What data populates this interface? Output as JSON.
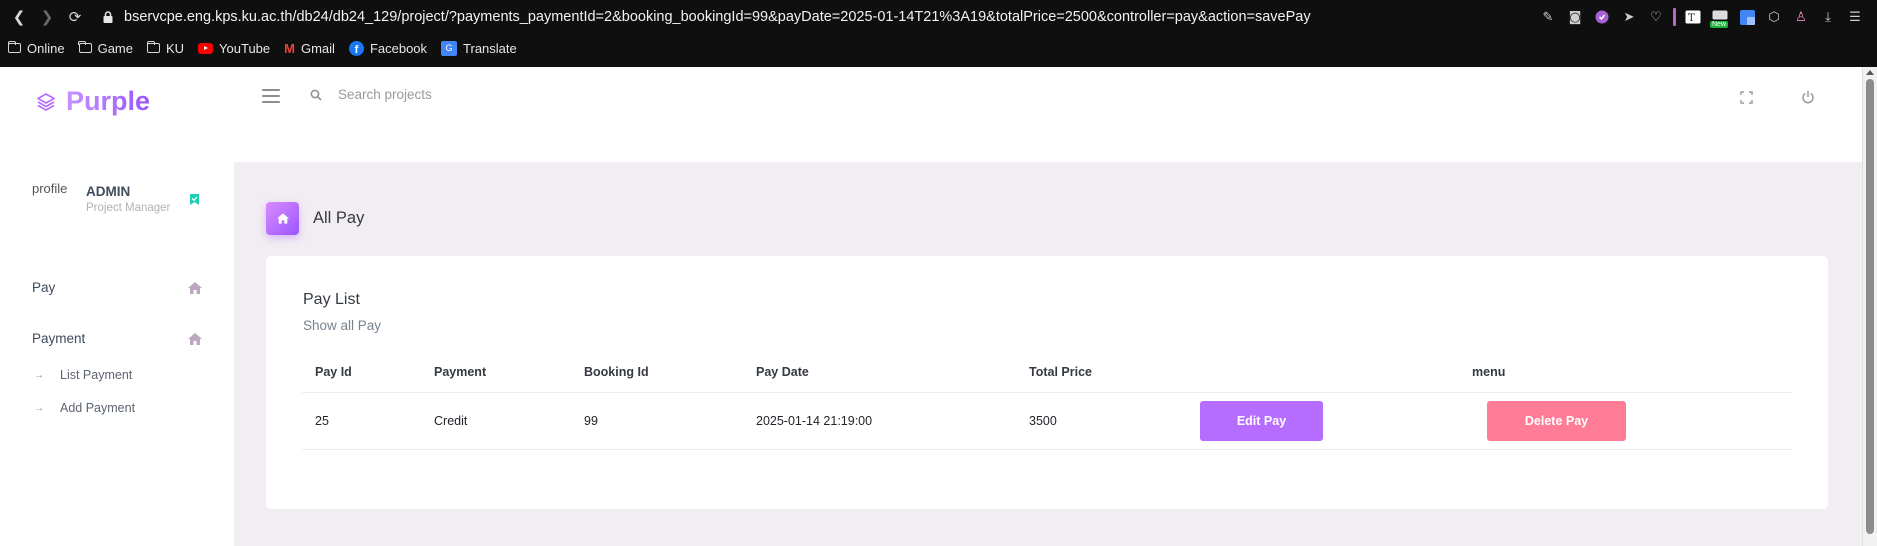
{
  "browser": {
    "url": "bservcpe.eng.kps.ku.ac.th/db24/db24_129/project/?payments_paymentId=2&booking_bookingId=99&payDate=2025-01-14T21%3A19&totalPrice=2500&controller=pay&action=savePay",
    "bookmarks": [
      "Online",
      "Game",
      "KU",
      "YouTube",
      "Gmail",
      "Facebook",
      "Translate"
    ],
    "new_badge": "New"
  },
  "app": {
    "brand": "Purple",
    "search_placeholder": "Search projects"
  },
  "profile": {
    "avatar_alt": "profile",
    "name": "ADMIN",
    "role": "Project Manager"
  },
  "sidebar": {
    "items": [
      {
        "label": "Pay"
      },
      {
        "label": "Payment"
      }
    ],
    "sub_items": [
      {
        "label": "List Payment"
      },
      {
        "label": "Add Payment"
      }
    ]
  },
  "page": {
    "title": "All Pay"
  },
  "card": {
    "title": "Pay List",
    "description": "Show all Pay"
  },
  "table": {
    "headers": [
      "Pay Id",
      "Payment",
      "Booking Id",
      "Pay Date",
      "Total Price",
      "menu"
    ],
    "rows": [
      {
        "pay_id": "25",
        "payment": "Credit",
        "booking_id": "99",
        "pay_date": "2025-01-14 21:19:00",
        "total_price": "3500",
        "edit_label": "Edit Pay",
        "delete_label": "Delete Pay"
      }
    ]
  },
  "colors": {
    "primary": "#b66dff",
    "danger": "#fe7c96",
    "content_bg": "#f2edf3",
    "badge_green": "#1bcfb4"
  }
}
